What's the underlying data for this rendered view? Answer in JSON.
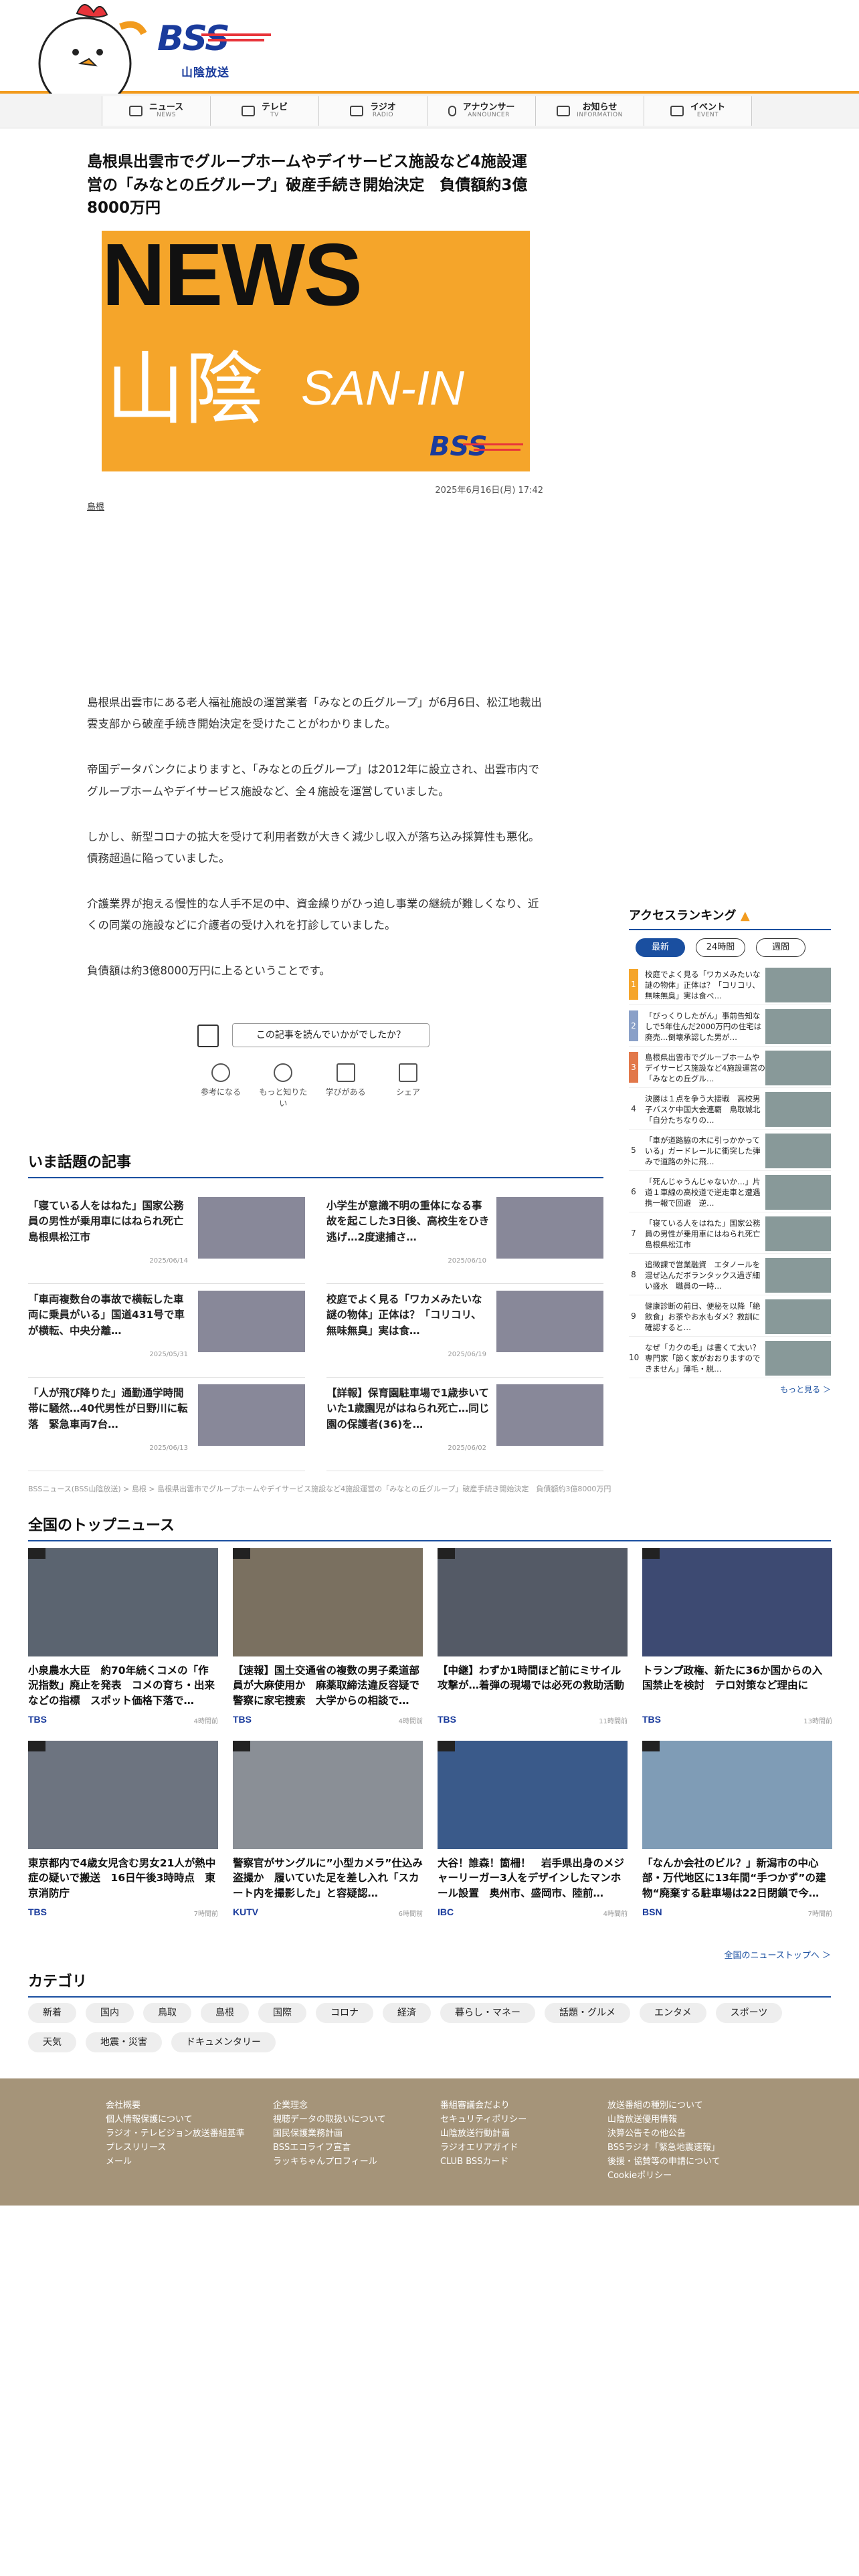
{
  "header": {
    "logo_text": "BSS",
    "logo_sub": "山陰放送"
  },
  "nav": [
    {
      "jp": "ニュース",
      "en": "NEWS",
      "icon": "newspaper-icon"
    },
    {
      "jp": "テレビ",
      "en": "TV",
      "icon": "tv-icon"
    },
    {
      "jp": "ラジオ",
      "en": "RADIO",
      "icon": "radio-icon"
    },
    {
      "jp": "アナウンサー",
      "en": "ANNOUNCER",
      "icon": "microphone-icon"
    },
    {
      "jp": "お知らせ",
      "en": "INFORMATION",
      "icon": "megaphone-icon"
    },
    {
      "jp": "イベント",
      "en": "EVENT",
      "icon": "calendar-icon"
    }
  ],
  "article": {
    "title": "島根県出雲市でグループホームやデイサービス施設など4施設運営の「みなとの丘グループ」破産手続き開始決定　負債額約3億8000万円",
    "hero": {
      "news": "NEWS",
      "sanin": "山陰",
      "sanin_en": "SAN-IN",
      "brand": "BSS"
    },
    "date": "2025年6月16日(月) 17:42",
    "tag": "島根",
    "paragraphs": [
      "島根県出雲市にある老人福祉施設の運営業者「みなとの丘グループ」が6月6日、松江地裁出雲支部から破産手続き開始決定を受けたことがわかりました。",
      "帝国データバンクによりますと、「みなとの丘グループ」は2012年に設立され、出雲市内でグループホームやデイサービス施設など、全４施設を運営していました。",
      "しかし、新型コロナの拡大を受けて利用者数が大きく減少し収入が落ち込み採算性も悪化。債務超過に陥っていました。",
      "介護業界が抱える慢性的な人手不足の中、資金繰りがひっ迫し事業の継続が難しくなり、近くの同業の施設などに介護者の受け入れを打診していました。",
      "負債額は約3億8000万円に上るということです。"
    ],
    "survey": "この記事を読んでいかがでしたか？",
    "reactions": [
      {
        "label": "参考になる",
        "icon": "lightbulb-icon"
      },
      {
        "label": "もっと知りたい",
        "icon": "magnifier-icon"
      },
      {
        "label": "学びがある",
        "icon": "book-icon"
      },
      {
        "label": "シェア",
        "icon": "share-icon"
      }
    ]
  },
  "trending": {
    "heading": "いま話題の記事",
    "items": [
      {
        "title": "「寝ている人をはねた」国家公務員の男性が乗用車にはねられ死亡　島根県松江市",
        "date": "2025/06/14"
      },
      {
        "title": "小学生が意識不明の重体になる事故を起こした3日後、高校生をひき逃げ…2度逮捕さ…",
        "date": "2025/06/10"
      },
      {
        "title": "「車両複数台の事故で横転した車両に乗員がいる」国道431号で車が横転、中央分離…",
        "date": "2025/05/31"
      },
      {
        "title": "校庭でよく見る「ワカメみたいな謎の物体」正体は？「コリコリ、無味無臭」実は食…",
        "date": "2025/06/19"
      },
      {
        "title": "「人が飛び降りた」通勤通学時間帯に騒然…40代男性が日野川に転落　緊急車両7台…",
        "date": "2025/06/13"
      },
      {
        "title": "【詳報】保育園駐車場で1歳歩いていた1歳園児がはねられ死亡…同じ園の保護者(36)を…",
        "date": "2025/06/02"
      }
    ]
  },
  "breadcrumb": "BSSニュース(BSS山陰放送) > 島根 > 島根県出雲市でグループホームやデイサービス施設など4施設運営の「みなとの丘グループ」破産手続き開始決定　負債額約3億8000万円",
  "top_news": {
    "heading": "全国のトップニュース",
    "items": [
      {
        "title": "小泉農水大臣　約70年続くコメの「作況指数」廃止を発表　コメの育ち・出来などの指標　スポット価格下落で…",
        "media": "TBS",
        "date": "4時間前"
      },
      {
        "title": "【速報】国土交通省の複数の男子柔道部員が大麻使用か　麻薬取締法違反容疑で警察に家宅捜索　大学からの相談で…",
        "media": "TBS",
        "date": "4時間前"
      },
      {
        "title": "【中継】わずか1時間ほど前にミサイル攻撃が…着弾の現場では必死の救助活動",
        "media": "TBS",
        "date": "11時間前"
      },
      {
        "title": "トランプ政権、新たに36か国からの入国禁止を検討　テロ対策など理由に",
        "media": "TBS",
        "date": "13時間前"
      },
      {
        "title": "東京都内で4歳女児含む男女21人が熱中症の疑いで搬送　16日午後3時時点　東京消防庁",
        "media": "TBS",
        "date": "7時間前"
      },
      {
        "title": "警察官がサングルに”小型カメラ”仕込み盗撮か　履いていた足を差し入れ「スカート内を撮影した」と容疑認…",
        "media": "KUTV",
        "date": "6時間前"
      },
      {
        "title": "大谷！誰森！箇柵！　岩手県出身のメジャーリーガー3人をデザインしたマンホール設置　奥州市、盛岡市、陸前…",
        "media": "IBC",
        "date": "4時間前"
      },
      {
        "title": "「なんか会社のビル？」新潟市の中心部・万代地区に13年間“手つかず”の建物“廃棄する駐車場は22日閉鎖で今…",
        "media": "BSN",
        "date": "7時間前"
      }
    ],
    "more": "全国のニューストップへ ＞"
  },
  "categories": {
    "heading": "カテゴリ",
    "items": [
      "新着",
      "国内",
      "鳥取",
      "島根",
      "国際",
      "コロナ",
      "経済",
      "暮らし・マネー",
      "話題・グルメ",
      "エンタメ",
      "スポーツ",
      "天気",
      "地震・災害",
      "ドキュメンタリー"
    ]
  },
  "ranking": {
    "heading": "アクセスランキング",
    "tabs": [
      "最新",
      "24時間",
      "週間"
    ],
    "items": [
      {
        "rank": "1",
        "title": "校庭でよく見る「ワカメみたいな謎の物体」正体は？「コリコリ、無味無臭」実は食べ…",
        "color": "#f5a52a"
      },
      {
        "rank": "2",
        "title": "「びっくりしたがん」事前告知なしで5年住んだ2000万円の住宅は廃売…倒壊承認した男が…",
        "color": "#8aa0c8"
      },
      {
        "rank": "3",
        "title": "島根県出雲市でグループホームやデイサービス施設など4施設運営の「みなとの丘グル…",
        "color": "#e2784a"
      },
      {
        "rank": "4",
        "title": "決勝は１点を争う大接戦　高校男子バスケ中国大会連覇　鳥取城北「自分たちなりの…",
        "color": ""
      },
      {
        "rank": "5",
        "title": "「車が道路脇の木に引っかかっている」ガードレールに衝突した弾みで道路の外に飛…",
        "color": ""
      },
      {
        "rank": "6",
        "title": "「死んじゃうんじゃないか…」片道１車線の高校道で逆走車と遭遇　携一報で回避　逆…",
        "color": ""
      },
      {
        "rank": "7",
        "title": "「寝ている人をはねた」国家公務員の男性が乗用車にはねられ死亡　島根県松江市",
        "color": ""
      },
      {
        "rank": "8",
        "title": "追徴課で営業融資　エタノールを混ぜ込んだボランタックス過ぎ細い盛水　職員の一時…",
        "color": ""
      },
      {
        "rank": "9",
        "title": "健康診断の前日、便秘を以降「絶飲食」お茶やお水もダメ？救訓に確認すると…",
        "color": ""
      },
      {
        "rank": "10",
        "title": "なぜ「カクの毛」は書くて太い？　専門家「節く家がおおりますのできません」薄毛・脱…",
        "color": ""
      }
    ],
    "more": "もっと見る ＞"
  },
  "footer": {
    "cols": [
      [
        "会社概要",
        "個人情報保護について",
        "ラジオ・テレビジョン放送番組基準",
        "プレスリリース",
        "メール"
      ],
      [
        "企業理念",
        "視聴データの取扱いについて",
        "国民保護業務計画",
        "BSSエコライフ宣言",
        "ラッキちゃんプロフィール"
      ],
      [
        "番組審議会だより",
        "セキュリティポリシー",
        "山陰放送行動計画",
        "ラジオエリアガイド",
        "CLUB BSSカード"
      ],
      [
        "放送番組の種別について",
        "山陰放送優用情報",
        "決算公告その他公告",
        "BSSラジオ「緊急地震速報」",
        "後援・協賛等の申請について",
        "Cookieポリシー"
      ]
    ]
  }
}
